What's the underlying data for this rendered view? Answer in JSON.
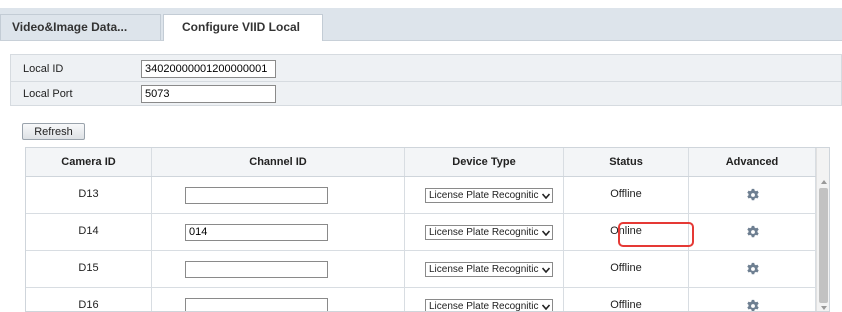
{
  "tabs": [
    {
      "label": "Video&Image Data...",
      "active": false
    },
    {
      "label": "Configure VIID Local",
      "active": true
    }
  ],
  "settings": {
    "local_id_label": "Local ID",
    "local_id_value": "34020000001200000001",
    "local_port_label": "Local Port",
    "local_port_value": "5073"
  },
  "refresh_label": "Refresh",
  "table": {
    "headers": [
      "Camera ID",
      "Channel ID",
      "Device Type",
      "Status",
      "Advanced"
    ],
    "rows": [
      {
        "camera_id": "D13",
        "channel_id": "",
        "device_type": "License Plate Recognitic",
        "status": "Offline"
      },
      {
        "camera_id": "D14",
        "channel_id": "014",
        "device_type": "License Plate Recognitic",
        "status": "Online"
      },
      {
        "camera_id": "D15",
        "channel_id": "",
        "device_type": "License Plate Recognitic",
        "status": "Offline"
      },
      {
        "camera_id": "D16",
        "channel_id": "",
        "device_type": "License Plate Recognitic",
        "status": "Offline"
      }
    ],
    "advanced_icon": "gear-icon",
    "highlighted_status_row": 1
  },
  "colors": {
    "highlight": "#e53935",
    "gear": "#6e7f91"
  }
}
